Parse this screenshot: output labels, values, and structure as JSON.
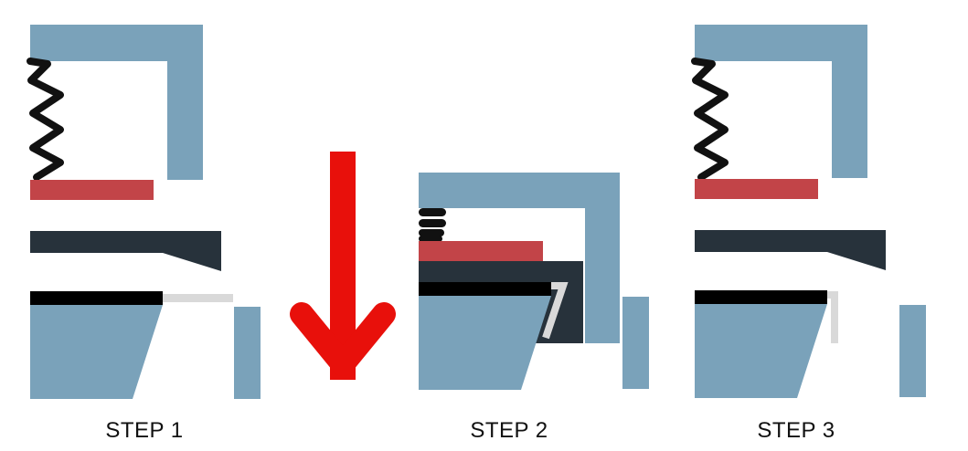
{
  "steps": [
    {
      "label": "STEP 1"
    },
    {
      "label": "STEP 2"
    },
    {
      "label": "STEP 3"
    }
  ],
  "arrow": {
    "direction": "down",
    "meaning": "press"
  },
  "colors": {
    "frame": "#7aa2ba",
    "spring": "#111111",
    "pad": "#c24448",
    "plate": "#27323b",
    "strip": "#000000",
    "wire": "#d9d9d9",
    "arrow": "#e8100b"
  }
}
